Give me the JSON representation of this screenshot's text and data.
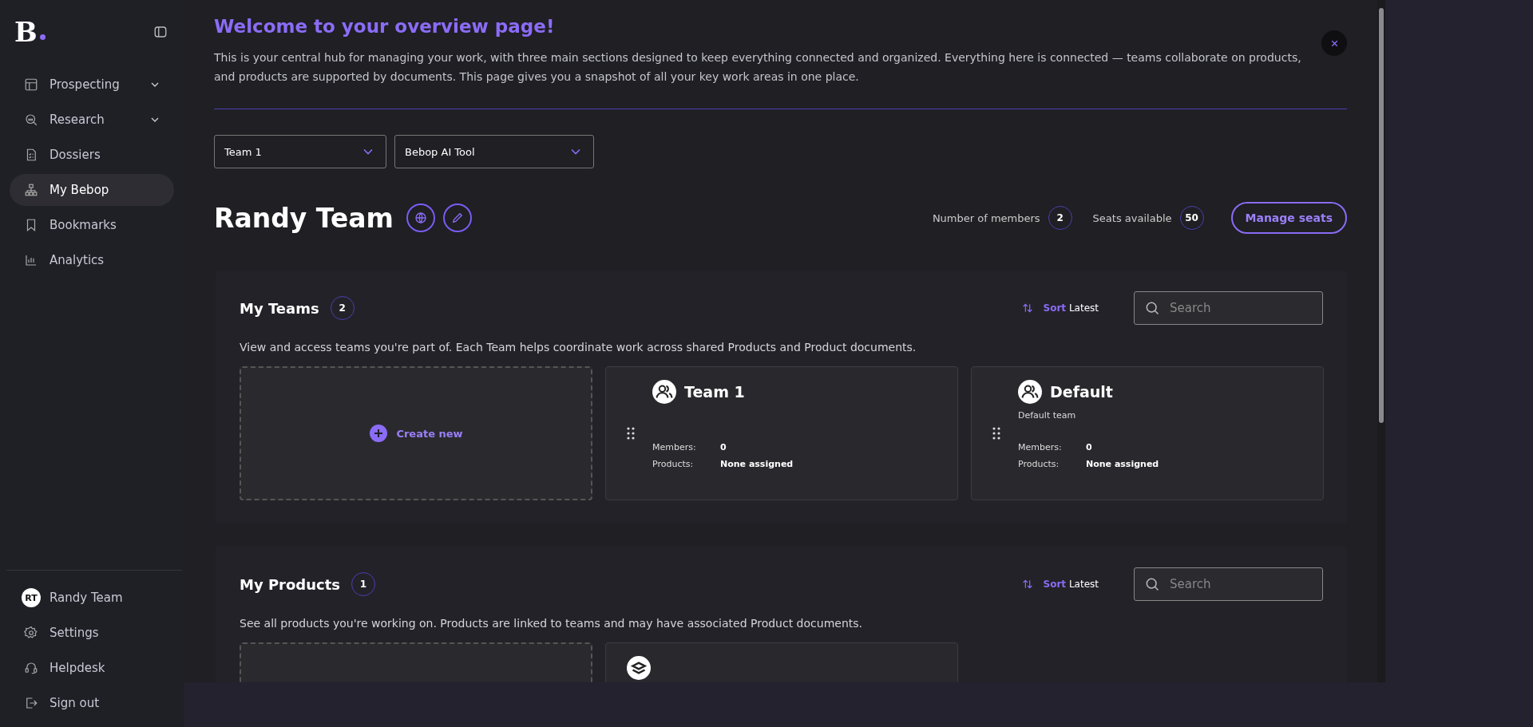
{
  "sidebar": {
    "logo": "B",
    "nav": [
      {
        "label": "Prospecting",
        "selected": false,
        "expandable": true
      },
      {
        "label": "Research",
        "selected": false,
        "expandable": true
      },
      {
        "label": "Dossiers",
        "selected": false,
        "expandable": false
      },
      {
        "label": "My Bebop",
        "selected": true,
        "expandable": false
      },
      {
        "label": "Bookmarks",
        "selected": false,
        "expandable": false
      },
      {
        "label": "Analytics",
        "selected": false,
        "expandable": false
      }
    ],
    "footer": [
      {
        "kind": "avatar",
        "initials": "RT",
        "label": "Randy Team"
      },
      {
        "kind": "icon",
        "label": "Settings"
      },
      {
        "kind": "icon",
        "label": "Helpdesk"
      },
      {
        "kind": "icon",
        "label": "Sign out"
      }
    ]
  },
  "intro": {
    "title": "Welcome to your overview page!",
    "text": "This is your central hub for managing your work, with three main sections designed to keep everything connected and organized. Everything here is connected — teams collaborate on products, and products are supported by documents. This page gives you a snapshot of all your key work areas in one place."
  },
  "filters": [
    {
      "value": "Team 1"
    },
    {
      "value": "Bebop AI Tool"
    }
  ],
  "team": {
    "name": "Randy Team",
    "stats": [
      {
        "label": "Number of members",
        "value": "2"
      },
      {
        "label": "Seats available",
        "value": "50"
      }
    ],
    "action": "Manage seats"
  },
  "sections": [
    {
      "title": "My Teams",
      "count": "2",
      "sort_label": "Sort",
      "sort_value": "Latest",
      "search": {
        "placeholder": "Search"
      },
      "description": "View and access teams you're part of. Each Team helps coordinate work across shared Products and Product documents.",
      "create": "Create new",
      "cards": [
        {
          "title": "Team 1",
          "fields": [
            {
              "label": "Members:",
              "value": "0"
            },
            {
              "label": "Products:",
              "value": "None assigned"
            }
          ]
        },
        {
          "title": "Default",
          "subtitle": "Default team",
          "fields": [
            {
              "label": "Members:",
              "value": "0"
            },
            {
              "label": "Products:",
              "value": "None assigned"
            }
          ]
        }
      ]
    },
    {
      "title": "My Products",
      "count": "1",
      "sort_label": "Sort",
      "sort_value": "Latest",
      "search": {
        "placeholder": "Search"
      },
      "description": "See all products you're working on. Products are linked to teams and may have associated Product documents.",
      "cards": [
        {
          "kind": "product"
        }
      ]
    }
  ]
}
